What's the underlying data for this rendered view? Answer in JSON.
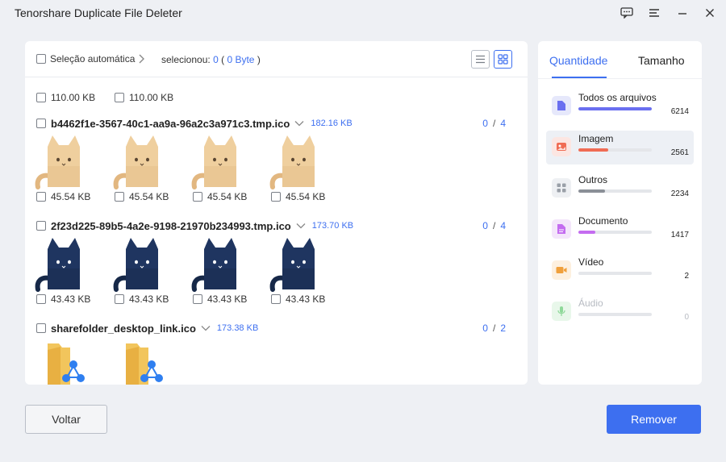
{
  "app": {
    "title": "Tenorshare Duplicate File Deleter",
    "icons": [
      "feedback-icon",
      "menu-icon",
      "minimize-icon",
      "close-icon"
    ]
  },
  "toolbar": {
    "auto_select_label": "Seleção automática",
    "selected_label": "selecionou:",
    "selected_count": "0",
    "selected_size": "0 Byte",
    "open_paren": "(",
    "close_paren": ")"
  },
  "top_sizes": [
    "110.00 KB",
    "110.00 KB"
  ],
  "groups": [
    {
      "name": "b4462f1e-3567-40c1-aa9a-96a2c3a971c3.tmp.ico",
      "size": "182.16 KB",
      "selected": "0",
      "total": "4",
      "thumb": "cat-light",
      "files": [
        "45.54 KB",
        "45.54 KB",
        "45.54 KB",
        "45.54 KB"
      ]
    },
    {
      "name": "2f23d225-89b5-4a2e-9198-21970b234993.tmp.ico",
      "size": "173.70 KB",
      "selected": "0",
      "total": "4",
      "thumb": "cat-dark",
      "files": [
        "43.43 KB",
        "43.43 KB",
        "43.43 KB",
        "43.43 KB"
      ]
    },
    {
      "name": "sharefolder_desktop_link.ico",
      "size": "173.38 KB",
      "selected": "0",
      "total": "2",
      "thumb": "share-folder",
      "files": []
    }
  ],
  "count_separator": "/",
  "tabs": [
    {
      "label": "Quantidade",
      "active": true
    },
    {
      "label": "Tamanho",
      "active": false
    }
  ],
  "categories": [
    {
      "label": "Todos os arquivos",
      "count": "6214",
      "fill": 1.0,
      "color": "#6a6ff0",
      "icon": "file-icon"
    },
    {
      "label": "Imagem",
      "count": "2561",
      "fill": 0.41,
      "color": "#f06c54",
      "icon": "image-icon"
    },
    {
      "label": "Outros",
      "count": "2234",
      "fill": 0.36,
      "color": "#8a8f97",
      "icon": "grid-icon"
    },
    {
      "label": "Documento",
      "count": "1417",
      "fill": 0.23,
      "color": "#c46cf0",
      "icon": "document-icon"
    },
    {
      "label": "Vídeo",
      "count": "2",
      "fill": 0.0,
      "color": "#f0a03c",
      "icon": "video-icon"
    },
    {
      "label": "Áudio",
      "count": "0",
      "fill": 0.0,
      "color": "#7fd38a",
      "icon": "microphone-icon"
    }
  ],
  "buttons": {
    "back": "Voltar",
    "remove": "Remover"
  },
  "colors": {
    "accent": "#3d6ff0",
    "background": "#eef0f4"
  }
}
